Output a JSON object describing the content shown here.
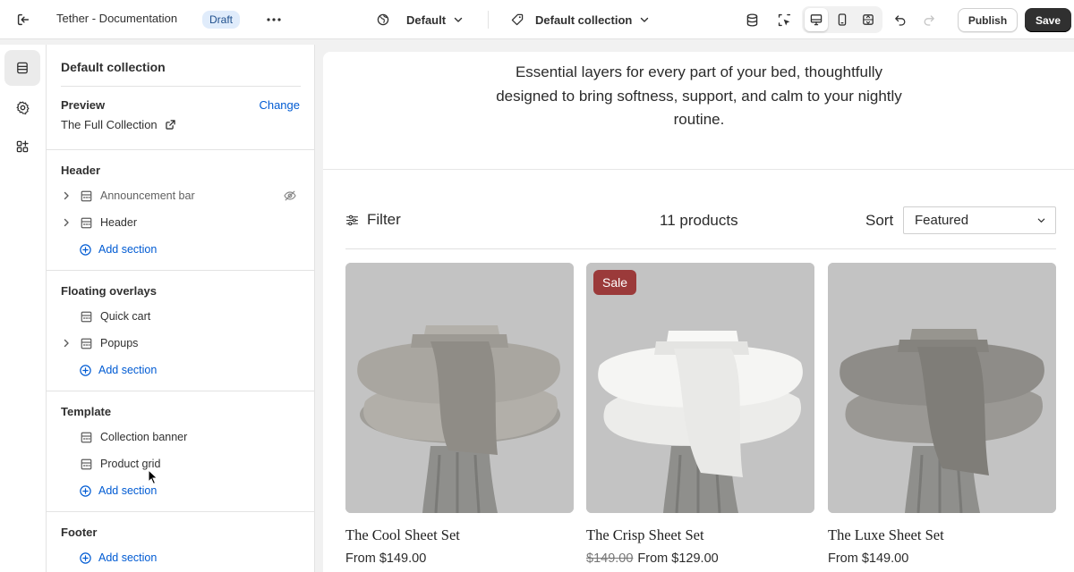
{
  "topbar": {
    "title": "Tether - Documentation",
    "badge": "Draft",
    "theme_label": "Default",
    "template_label": "Default collection",
    "publish_label": "Publish",
    "save_label": "Save"
  },
  "panel": {
    "title": "Default collection",
    "preview": {
      "label": "Preview",
      "change_label": "Change",
      "value": "The Full Collection"
    },
    "groups": {
      "header": {
        "title": "Header",
        "items": [
          "Announcement bar",
          "Header"
        ],
        "add_label": "Add section"
      },
      "overlays": {
        "title": "Floating overlays",
        "items": [
          "Quick cart",
          "Popups"
        ],
        "add_label": "Add section"
      },
      "template": {
        "title": "Template",
        "items": [
          "Collection banner",
          "Product grid"
        ],
        "add_label": "Add section"
      },
      "footer": {
        "title": "Footer",
        "add_label": "Add section"
      }
    }
  },
  "canvas": {
    "banner_text": "Essential layers for every part of your bed, thoughtfully designed to bring softness, support, and calm to your nightly routine.",
    "filter_label": "Filter",
    "count_label": "11 products",
    "sort_label": "Sort",
    "sort_value": "Featured",
    "products": [
      {
        "name": "The Cool Sheet Set",
        "price": "From $149.00",
        "compare": "",
        "badge": ""
      },
      {
        "name": "The Crisp Sheet Set",
        "price": "From $129.00",
        "compare": "$149.00",
        "badge": "Sale"
      },
      {
        "name": "The Luxe Sheet Set",
        "price": "From $149.00",
        "compare": "",
        "badge": ""
      }
    ]
  },
  "colors": {
    "accent_link": "#005bd3",
    "badge_bg": "#e0ecfb",
    "sale_badge": "#9b3a3a",
    "save_button": "#303030"
  }
}
